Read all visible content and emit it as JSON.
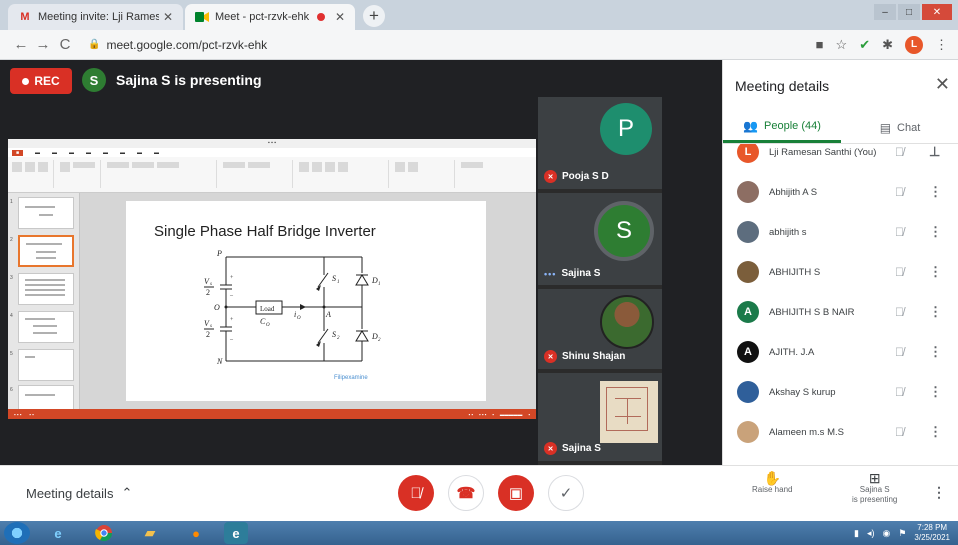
{
  "browser": {
    "tabs": [
      {
        "label": "Meeting invite: Lji Ramesan San",
        "icon": "gmail-icon"
      },
      {
        "label": "Meet - pct-rzvk-ehk",
        "icon": "meet-icon"
      }
    ],
    "url": "meet.google.com/pct-rzvk-ehk"
  },
  "meeting": {
    "rec_label": "REC",
    "presenter_initial": "S",
    "presenter_text": "Sajina S is presenting"
  },
  "slide": {
    "title": "Single Phase Half Bridge Inverter",
    "credit": "Filipexamine",
    "circuit": {
      "p": "P",
      "o": "O",
      "n": "N",
      "a": "A",
      "load": "Load",
      "vs_num_top": "V",
      "vs_sub": "s",
      "vs_den": "2",
      "co": "C",
      "co_sub": "O",
      "io": "i",
      "io_sub": "O",
      "s1": "S",
      "s1_sub": "1",
      "s2": "S",
      "s2_sub": "2",
      "d1": "D",
      "d1_sub": "1",
      "d2": "D",
      "d2_sub": "2"
    }
  },
  "participants_tiles": [
    {
      "initial": "P",
      "name": "Pooja S D",
      "color": "#1e8e6e",
      "muted": true
    },
    {
      "initial": "S",
      "name": "Sajina S",
      "color": "#2e7d32",
      "muted": false
    },
    {
      "name": "Shinu Shajan",
      "muted": true
    },
    {
      "name": "Sajina S",
      "muted": true
    }
  ],
  "panel": {
    "title": "Meeting details",
    "tab_people": "People (44)",
    "tab_chat": "Chat",
    "people": [
      {
        "initial": "L",
        "name": "Lji Ramesan Santhi (You)",
        "color": "#e8572a",
        "action": "pin-icon"
      },
      {
        "initial": "",
        "name": "Abhijith A S",
        "color": "#8d6e63",
        "action": "more-icon"
      },
      {
        "initial": "",
        "name": "abhijith s",
        "color": "#5d6d7e",
        "action": "more-icon"
      },
      {
        "initial": "",
        "name": "ABHIJITH S",
        "color": "#7b5e3b",
        "action": "more-icon"
      },
      {
        "initial": "A",
        "name": "ABHIJITH S B NAIR",
        "color": "#1b7a4a",
        "action": "more-icon"
      },
      {
        "initial": "A",
        "name": "AJITH. J.A",
        "color": "#111111",
        "action": "more-icon"
      },
      {
        "initial": "",
        "name": "Akshay S kurup",
        "color": "#2f5f9a",
        "action": "more-icon"
      },
      {
        "initial": "",
        "name": "Alameen m.s M.S",
        "color": "#c9a27a",
        "action": "more-icon"
      }
    ]
  },
  "bottom": {
    "meeting_details": "Meeting details",
    "raise_hand": "Raise hand",
    "presenting_line1": "Sajina S",
    "presenting_line2": "is presenting"
  },
  "taskbar": {
    "time": "7:28 PM",
    "date": "3/25/2021"
  },
  "colors": {
    "meet_red": "#d93025",
    "meet_green": "#188038",
    "ppt_orange": "#d24726"
  }
}
